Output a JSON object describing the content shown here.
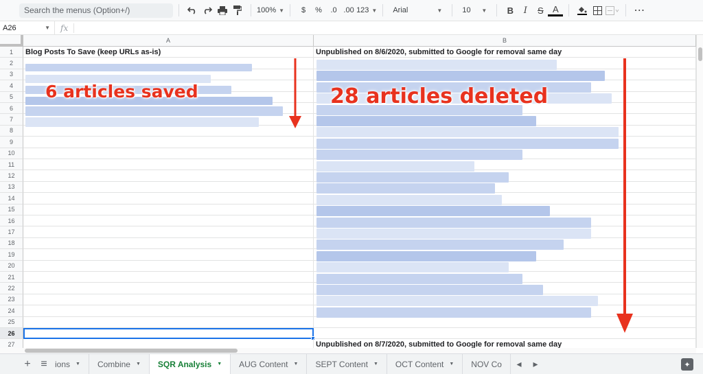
{
  "toolbar": {
    "search_placeholder": "Search the menus (Option+/)",
    "zoom": "100%",
    "currency": "$",
    "percent": "%",
    "decrease_decimals": ".0",
    "increase_decimals": ".00",
    "more_formats": "123",
    "font": "Arial",
    "font_size": "10",
    "bold": "B",
    "italic": "I",
    "strikethrough": "S",
    "text_color": "A",
    "more": "⋯"
  },
  "formula_bar": {
    "cell_ref": "A26",
    "fx": "fx"
  },
  "columns": [
    "A",
    "B"
  ],
  "rows": [
    "1",
    "2",
    "3",
    "4",
    "5",
    "6",
    "7",
    "8",
    "9",
    "10",
    "11",
    "12",
    "13",
    "14",
    "15",
    "16",
    "17",
    "18",
    "19",
    "20",
    "21",
    "22",
    "23",
    "24",
    "25",
    "26",
    "27"
  ],
  "selected_row": "26",
  "cells": {
    "a1": "Blog Posts To Save (keep URLs as-is)",
    "b1": "Unpublished on 8/6/2020, submitted to Google for removal same day",
    "b27": "Unpublished on 8/7/2020, submitted to Google for removal same day"
  },
  "annotations": {
    "saved": "6 articles saved",
    "deleted": "28 articles deleted",
    "color": "#e8321e"
  },
  "sheet_tabs": {
    "add": "+",
    "all_sheets": "≡",
    "tabs": [
      {
        "label": "ions"
      },
      {
        "label": "Combine"
      },
      {
        "label": "SQR Analysis"
      },
      {
        "label": "AUG Content"
      },
      {
        "label": "SEPT Content"
      },
      {
        "label": "OCT Content"
      },
      {
        "label": "NOV Co"
      }
    ],
    "active_tab": "SQR Analysis",
    "prev": "◂",
    "next": "▸"
  },
  "colors": {
    "accent": "#1a73e8",
    "active_tab": "#188038",
    "blur": "#c5d3ef"
  }
}
